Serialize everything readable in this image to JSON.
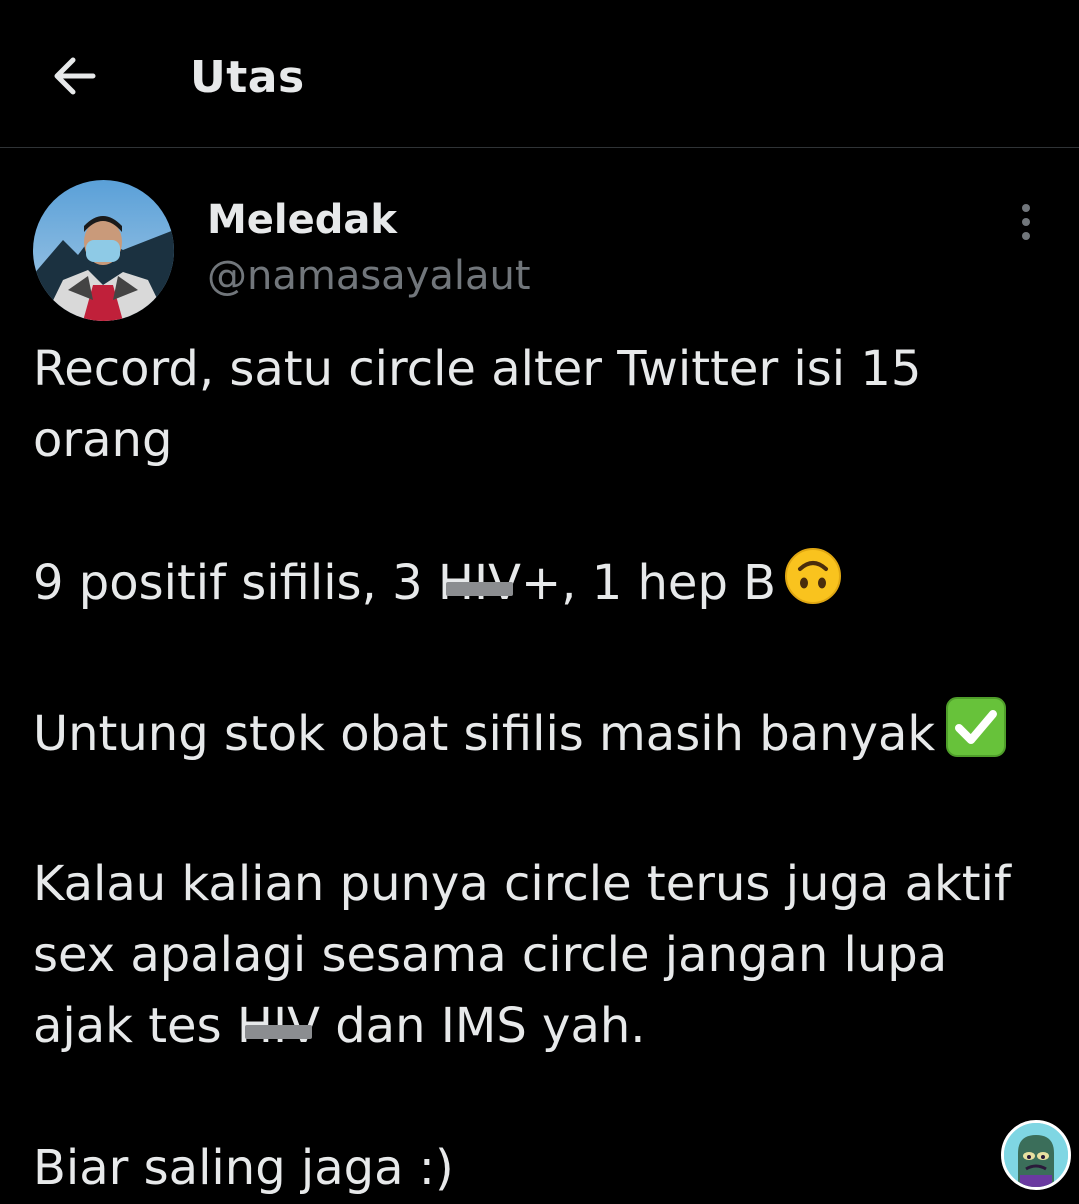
{
  "header": {
    "back_icon": "arrow-left-icon",
    "title": "Utas"
  },
  "author": {
    "display_name": "Meledak",
    "handle": "@namasayalaut",
    "more_icon": "more-vertical-icon"
  },
  "tweet": {
    "line1": "Record, satu circle alter Twitter isi 15",
    "line2": "orang",
    "p2_before": "9 positif sifilis, 3 ",
    "p2_censored": "HIV",
    "p2_after": "+, 1 hep B",
    "p2_emoji": "upside-down-face-emoji",
    "p3_text": "Untung stok obat sifilis masih banyak",
    "p3_emoji": "check-mark-button-emoji",
    "p4_line1": "Kalau kalian punya circle terus juga aktif",
    "p4_line2": "sex apalagi sesama circle jangan lupa",
    "p4_line3_before": "ajak tes ",
    "p4_line3_censored": "HIV",
    "p4_line3_after": " dan IMS yah.",
    "p5": "Biar saling jaga :)"
  },
  "colors": {
    "background": "#000000",
    "text": "#e7e9ea",
    "secondary_text": "#71767b",
    "divider": "#2f3336"
  }
}
